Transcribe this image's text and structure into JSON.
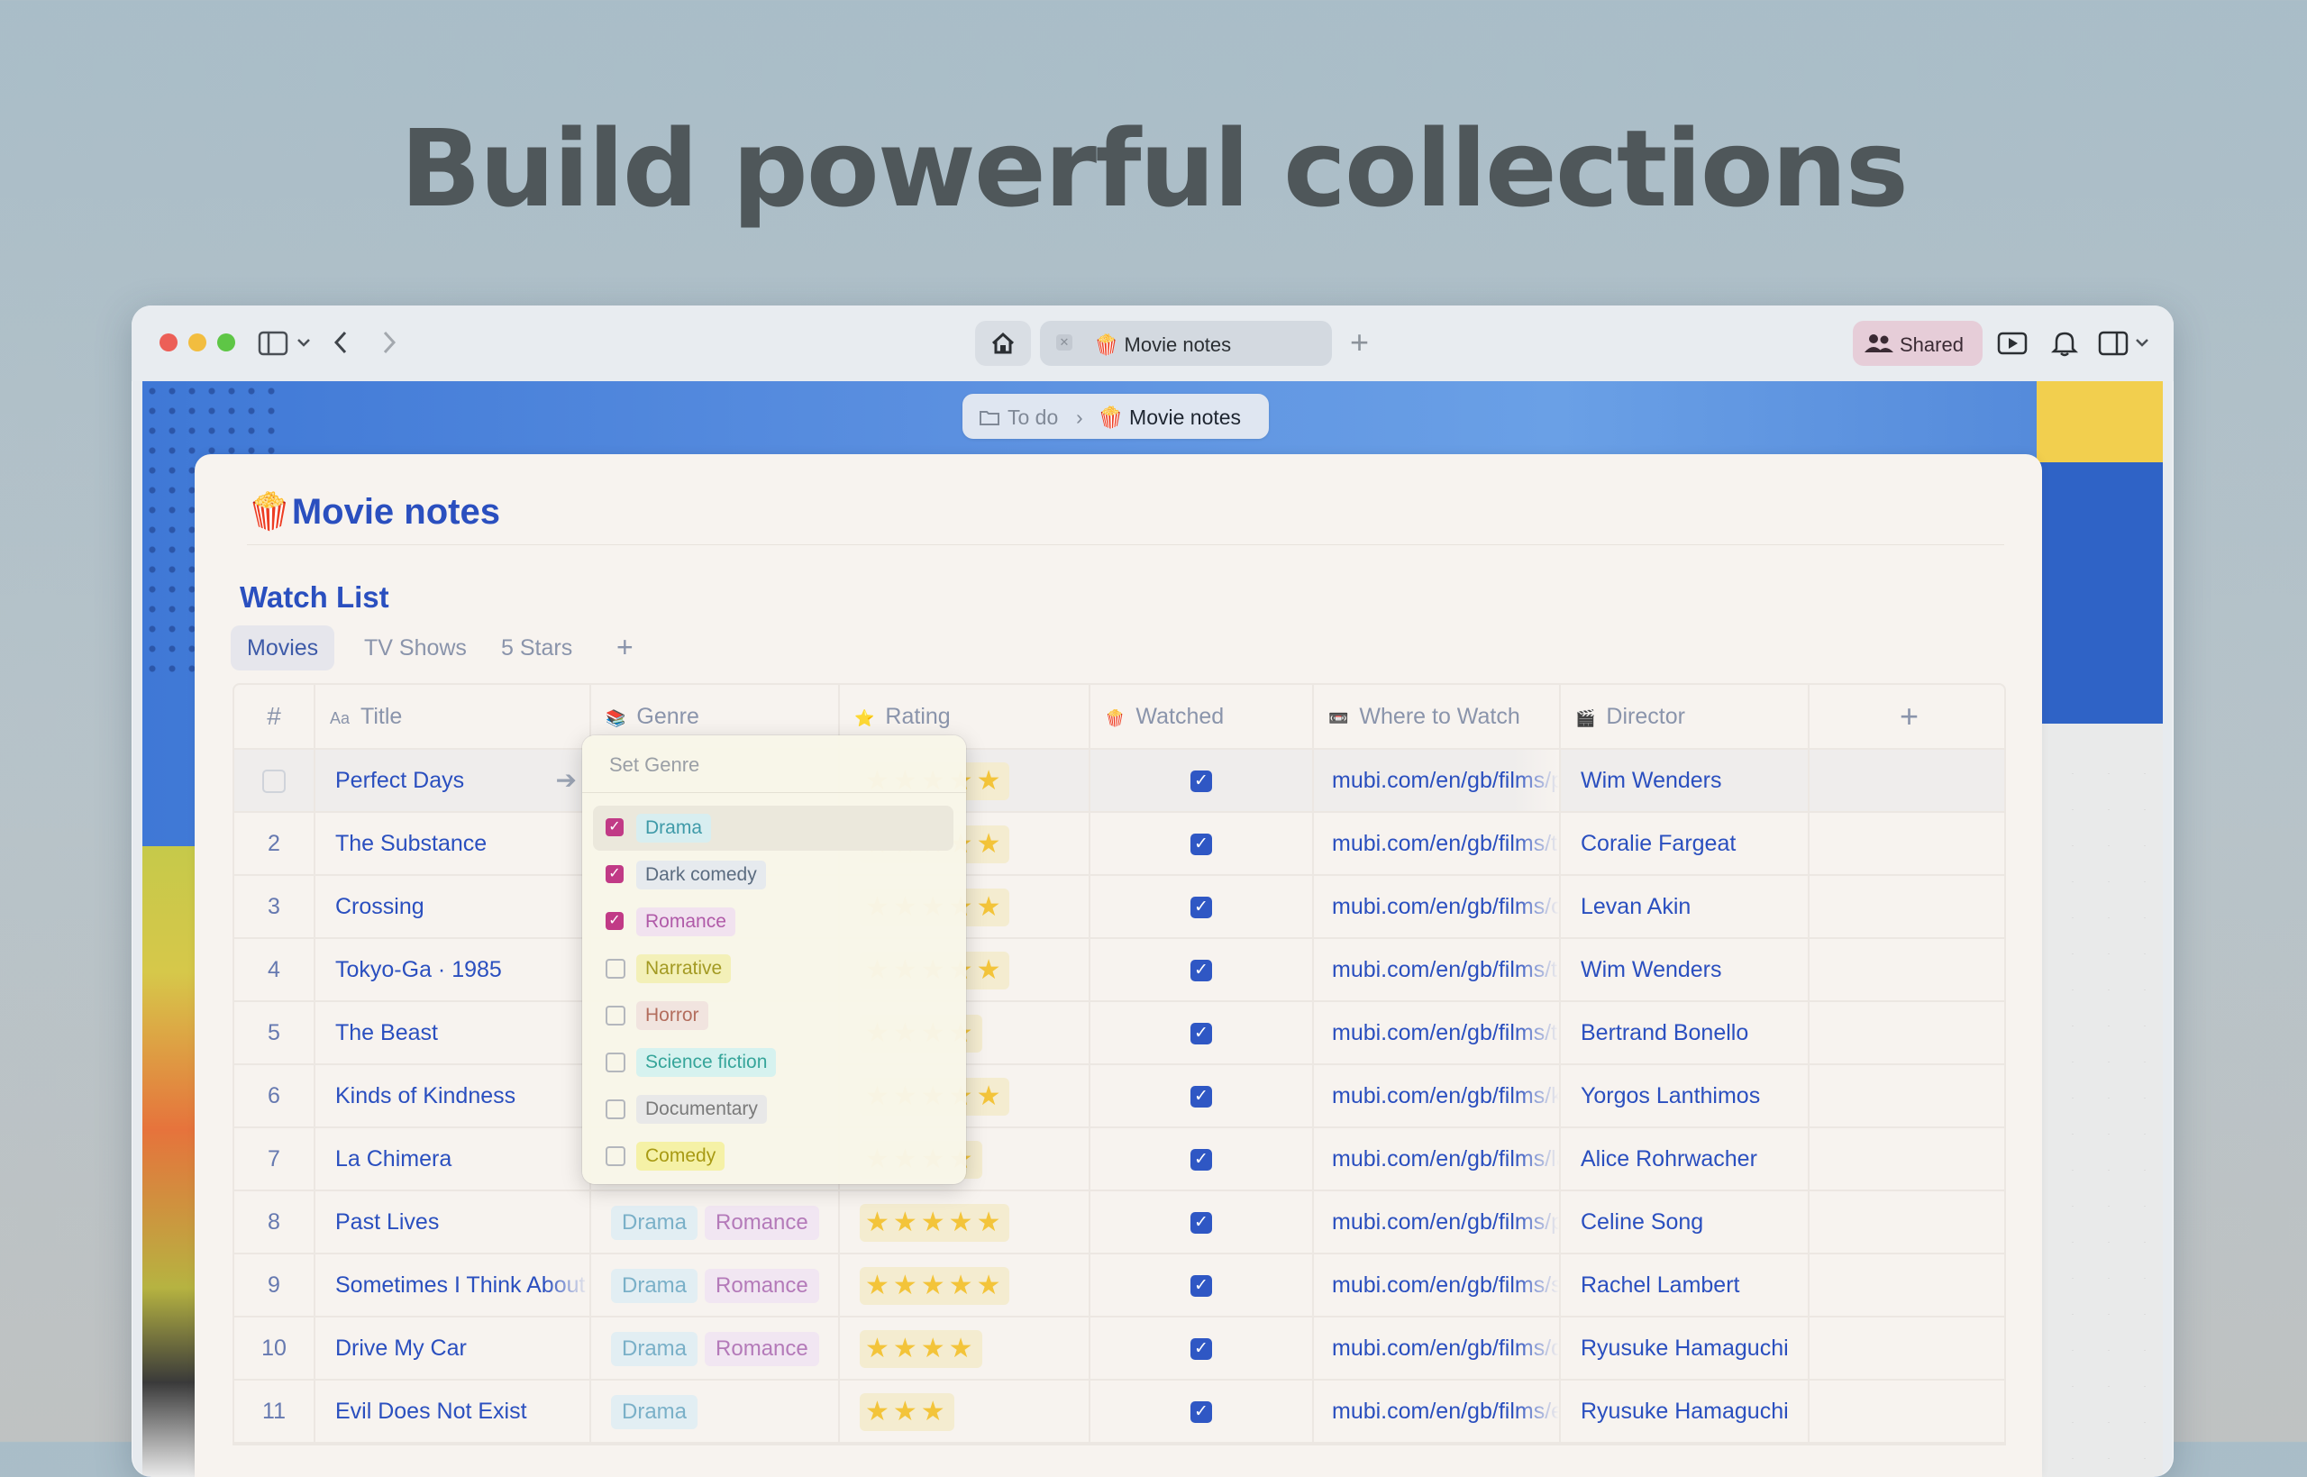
{
  "headline": "Build powerful collections",
  "window": {
    "tab": {
      "emoji": "🍿",
      "label": "Movie notes"
    },
    "shared_label": "Shared",
    "breadcrumb": {
      "parent": "To do",
      "current": "Movie notes",
      "current_emoji": "🍿"
    }
  },
  "page": {
    "title_emoji": "🍿",
    "title": "Movie notes",
    "collection_title": "Watch List",
    "views": [
      "Movies",
      "TV Shows",
      "5 Stars"
    ],
    "active_view": "Movies"
  },
  "table": {
    "columns": [
      {
        "key": "num",
        "label": "#",
        "icon": ""
      },
      {
        "key": "title",
        "label": "Title",
        "icon": "Aa"
      },
      {
        "key": "genre",
        "label": "Genre",
        "icon": "📚"
      },
      {
        "key": "rating",
        "label": "Rating",
        "icon": "⭐"
      },
      {
        "key": "watched",
        "label": "Watched",
        "icon": "🍿"
      },
      {
        "key": "where",
        "label": "Where to Watch",
        "icon": "📼"
      },
      {
        "key": "director",
        "label": "Director",
        "icon": "🎬"
      }
    ],
    "rows": [
      {
        "num": "",
        "title": "Perfect Days",
        "genres": [],
        "rating": 5,
        "watched": true,
        "where": "mubi.com/en/gb/films/perfect-days",
        "director": "Wim Wenders"
      },
      {
        "num": "2",
        "title": "The Substance",
        "genres": [],
        "rating": 5,
        "watched": true,
        "where": "mubi.com/en/gb/films/the-substance",
        "director": "Coralie Fargeat"
      },
      {
        "num": "3",
        "title": "Crossing",
        "genres": [],
        "rating": 5,
        "watched": true,
        "where": "mubi.com/en/gb/films/crossing",
        "director": "Levan Akin"
      },
      {
        "num": "4",
        "title": "Tokyo-Ga · 1985",
        "genres": [],
        "rating": 5,
        "watched": true,
        "where": "mubi.com/en/gb/films/tokyo-ga",
        "director": "Wim Wenders"
      },
      {
        "num": "5",
        "title": "The Beast",
        "genres": [],
        "rating": 4,
        "watched": true,
        "where": "mubi.com/en/gb/films/the-beast",
        "director": "Bertrand Bonello"
      },
      {
        "num": "6",
        "title": "Kinds of Kindness",
        "genres": [],
        "rating": 5,
        "watched": true,
        "where": "mubi.com/en/gb/films/kinds-of-kindness",
        "director": "Yorgos Lanthimos"
      },
      {
        "num": "7",
        "title": "La Chimera",
        "genres": [],
        "rating": 4,
        "watched": true,
        "where": "mubi.com/en/gb/films/la-chimera",
        "director": "Alice Rohrwacher"
      },
      {
        "num": "8",
        "title": "Past Lives",
        "genres": [
          "Drama",
          "Romance"
        ],
        "rating": 5,
        "watched": true,
        "where": "mubi.com/en/gb/films/past-lives",
        "director": "Celine Song"
      },
      {
        "num": "9",
        "title": "Sometimes I Think About Dying",
        "genres": [
          "Drama",
          "Romance"
        ],
        "rating": 5,
        "watched": true,
        "where": "mubi.com/en/gb/films/sometimes",
        "director": "Rachel Lambert"
      },
      {
        "num": "10",
        "title": "Drive My Car",
        "genres": [
          "Drama",
          "Romance"
        ],
        "rating": 4,
        "watched": true,
        "where": "mubi.com/en/gb/films/drive-my-car",
        "director": "Ryusuke Hamaguchi"
      },
      {
        "num": "11",
        "title": "Evil Does Not Exist",
        "genres": [
          "Drama"
        ],
        "rating": 3,
        "watched": true,
        "where": "mubi.com/en/gb/films/evil-does-not-exist",
        "director": "Ryusuke Hamaguchi"
      }
    ]
  },
  "genre_dropdown": {
    "header": "Set Genre",
    "options": [
      {
        "label": "Drama",
        "checked": true,
        "bg": "#d8eef0",
        "fg": "#3f9aa8"
      },
      {
        "label": "Dark comedy",
        "checked": true,
        "bg": "#e6eaee",
        "fg": "#5b6c80"
      },
      {
        "label": "Romance",
        "checked": true,
        "bg": "#f1e2ef",
        "fg": "#b05aa8"
      },
      {
        "label": "Narrative",
        "checked": false,
        "bg": "#f3f0b8",
        "fg": "#a39a23"
      },
      {
        "label": "Horror",
        "checked": false,
        "bg": "#f1e4df",
        "fg": "#b36d5d"
      },
      {
        "label": "Science fiction",
        "checked": false,
        "bg": "#d6f2ef",
        "fg": "#36a59a"
      },
      {
        "label": "Documentary",
        "checked": false,
        "bg": "#e8e8e8",
        "fg": "#7a7a7a"
      },
      {
        "label": "Comedy",
        "checked": false,
        "bg": "#f5f1a6",
        "fg": "#a89a13"
      }
    ]
  },
  "side_tools": [
    "plus-icon",
    "font-icon",
    "brush-icon",
    "info-icon"
  ]
}
